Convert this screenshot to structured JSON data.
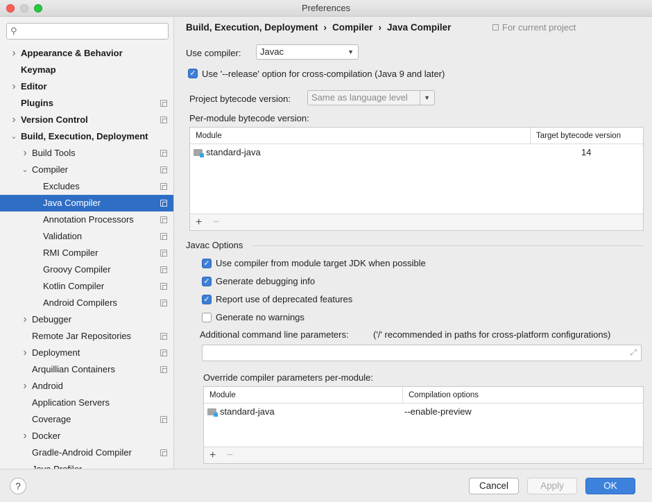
{
  "window": {
    "title": "Preferences"
  },
  "search": {
    "placeholder": ""
  },
  "tree": [
    {
      "label": "Appearance & Behavior",
      "level": 0,
      "bold": true,
      "arrow": "›",
      "copy": false
    },
    {
      "label": "Keymap",
      "level": 0,
      "bold": true,
      "arrow": "",
      "copy": false
    },
    {
      "label": "Editor",
      "level": 0,
      "bold": true,
      "arrow": "›",
      "copy": false
    },
    {
      "label": "Plugins",
      "level": 0,
      "bold": true,
      "arrow": "",
      "copy": true
    },
    {
      "label": "Version Control",
      "level": 0,
      "bold": true,
      "arrow": "›",
      "copy": true
    },
    {
      "label": "Build, Execution, Deployment",
      "level": 0,
      "bold": true,
      "arrow": "⌄",
      "copy": false
    },
    {
      "label": "Build Tools",
      "level": 1,
      "bold": false,
      "arrow": "›",
      "copy": true
    },
    {
      "label": "Compiler",
      "level": 1,
      "bold": false,
      "arrow": "⌄",
      "copy": true
    },
    {
      "label": "Excludes",
      "level": 2,
      "bold": false,
      "arrow": "",
      "copy": true
    },
    {
      "label": "Java Compiler",
      "level": 2,
      "bold": false,
      "arrow": "",
      "copy": true,
      "selected": true
    },
    {
      "label": "Annotation Processors",
      "level": 2,
      "bold": false,
      "arrow": "",
      "copy": true
    },
    {
      "label": "Validation",
      "level": 2,
      "bold": false,
      "arrow": "",
      "copy": true
    },
    {
      "label": "RMI Compiler",
      "level": 2,
      "bold": false,
      "arrow": "",
      "copy": true
    },
    {
      "label": "Groovy Compiler",
      "level": 2,
      "bold": false,
      "arrow": "",
      "copy": true
    },
    {
      "label": "Kotlin Compiler",
      "level": 2,
      "bold": false,
      "arrow": "",
      "copy": true
    },
    {
      "label": "Android Compilers",
      "level": 2,
      "bold": false,
      "arrow": "",
      "copy": true
    },
    {
      "label": "Debugger",
      "level": 1,
      "bold": false,
      "arrow": "›",
      "copy": false
    },
    {
      "label": "Remote Jar Repositories",
      "level": 1,
      "bold": false,
      "arrow": "",
      "copy": true
    },
    {
      "label": "Deployment",
      "level": 1,
      "bold": false,
      "arrow": "›",
      "copy": true
    },
    {
      "label": "Arquillian Containers",
      "level": 1,
      "bold": false,
      "arrow": "",
      "copy": true
    },
    {
      "label": "Android",
      "level": 1,
      "bold": false,
      "arrow": "›",
      "copy": false
    },
    {
      "label": "Application Servers",
      "level": 1,
      "bold": false,
      "arrow": "",
      "copy": false
    },
    {
      "label": "Coverage",
      "level": 1,
      "bold": false,
      "arrow": "",
      "copy": true
    },
    {
      "label": "Docker",
      "level": 1,
      "bold": false,
      "arrow": "›",
      "copy": false
    },
    {
      "label": "Gradle-Android Compiler",
      "level": 1,
      "bold": false,
      "arrow": "",
      "copy": true
    },
    {
      "label": "Java Profiler",
      "level": 1,
      "bold": false,
      "arrow": "",
      "copy": false
    }
  ],
  "breadcrumb": {
    "part1": "Build, Execution, Deployment",
    "part2": "Compiler",
    "part3": "Java Compiler",
    "separator": "›",
    "scope": "For current project"
  },
  "compiler": {
    "use_compiler_label": "Use compiler:",
    "use_compiler_value": "Javac",
    "release_option_label": "Use '--release' option for cross-compilation (Java 9 and later)",
    "release_option_checked": true,
    "bytecode_label": "Project bytecode version:",
    "bytecode_value": "Same as language level",
    "per_module_label": "Per-module bytecode version:"
  },
  "bytecode_table": {
    "col_module": "Module",
    "col_target": "Target bytecode version",
    "rows": [
      {
        "module": "standard-java",
        "target": "14"
      }
    ],
    "add": "+",
    "remove": "−"
  },
  "javac": {
    "group_title": "Javac Options",
    "options": [
      {
        "label": "Use compiler from module target JDK when possible",
        "checked": true
      },
      {
        "label": "Generate debugging info",
        "checked": true
      },
      {
        "label": "Report use of deprecated features",
        "checked": true
      },
      {
        "label": "Generate no warnings",
        "checked": false
      }
    ],
    "additional_label": "Additional command line parameters:",
    "additional_hint": "('/' recommended in paths for cross-platform configurations)",
    "additional_value": "",
    "override_label": "Override compiler parameters per-module:"
  },
  "override_table": {
    "col_module": "Module",
    "col_options": "Compilation options",
    "rows": [
      {
        "module": "standard-java",
        "options": "--enable-preview"
      }
    ],
    "add": "+",
    "remove": "−"
  },
  "footer": {
    "help": "?",
    "cancel": "Cancel",
    "apply": "Apply",
    "ok": "OK"
  }
}
